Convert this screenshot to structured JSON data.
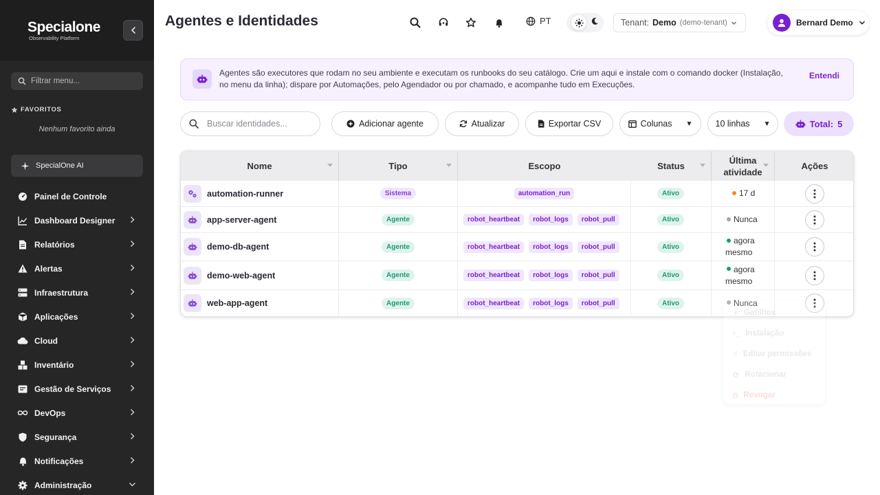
{
  "brand": {
    "logo_word": "Specialone",
    "logo_sub": "Observability Platform"
  },
  "sidebar": {
    "filter_placeholder": "Filtrar menu...",
    "favorites_title": "FAVORITOS",
    "favorites_empty": "Nenhum favorito ainda",
    "ai_label": "SpecialOne AI",
    "items": [
      {
        "label": "Painel de Controle",
        "icon": "dashboard-icon",
        "chevron": ""
      },
      {
        "label": "Dashboard Designer",
        "icon": "chart-line-icon",
        "chevron": "right"
      },
      {
        "label": "Relatórios",
        "icon": "report-icon",
        "chevron": "right"
      },
      {
        "label": "Alertas",
        "icon": "alert-icon",
        "chevron": "right"
      },
      {
        "label": "Infraestrutura",
        "icon": "server-icon",
        "chevron": "right"
      },
      {
        "label": "Aplicações",
        "icon": "package-icon",
        "chevron": "right"
      },
      {
        "label": "Cloud",
        "icon": "cloud-icon",
        "chevron": "right"
      },
      {
        "label": "Inventário",
        "icon": "boxes-icon",
        "chevron": "right"
      },
      {
        "label": "Gestão de Serviços",
        "icon": "service-icon",
        "chevron": "right"
      },
      {
        "label": "DevOps",
        "icon": "infinity-icon",
        "chevron": "right"
      },
      {
        "label": "Segurança",
        "icon": "shield-icon",
        "chevron": "right"
      },
      {
        "label": "Notificações",
        "icon": "bell-icon",
        "chevron": "right"
      },
      {
        "label": "Administração",
        "icon": "gear-icon",
        "chevron": "down"
      }
    ]
  },
  "header": {
    "title": "Agentes e Identidades",
    "lang": "PT",
    "tenant_label": "Tenant:",
    "tenant_name": "Demo",
    "tenant_slug": "(demo-tenant)",
    "user_name": "Bernard Demo"
  },
  "banner": {
    "text": "Agentes são executores que rodam no seu ambiente e executam os runbooks do seu catálogo. Crie um aqui e instale com o comando docker (Instalação, no menu da linha); dispare por Automações, pelo Agendador ou por chamado, e acompanhe tudo em Execuções.",
    "dismiss": "Entendi"
  },
  "toolbar": {
    "search_placeholder": "Buscar identidades...",
    "add": "Adicionar agente",
    "refresh": "Atualizar",
    "export": "Exportar CSV",
    "columns": "Colunas",
    "rows": "10 linhas",
    "total_label": "Total:",
    "total_value": "5"
  },
  "table": {
    "headers": {
      "name": "Nome",
      "type": "Tipo",
      "scope": "Escopo",
      "status": "Status",
      "last_line1": "Última",
      "last_line2": "atividade",
      "actions": "Ações"
    },
    "rows": [
      {
        "name": "automation-runner",
        "type": "Sistema",
        "type_kind": "sys",
        "scopes": [
          "automation_run"
        ],
        "status": "Ativo",
        "activity": [
          "17 d"
        ],
        "dot": "#f08a24"
      },
      {
        "name": "app-server-agent",
        "type": "Agente",
        "type_kind": "ag",
        "scopes": [
          "robot_heartbeat",
          "robot_logs",
          "robot_pull"
        ],
        "status": "Ativo",
        "activity": [
          "Nunca"
        ],
        "dot": "#a0a4ad"
      },
      {
        "name": "demo-db-agent",
        "type": "Agente",
        "type_kind": "ag",
        "scopes": [
          "robot_heartbeat",
          "robot_logs",
          "robot_pull"
        ],
        "status": "Ativo",
        "activity": [
          "agora",
          "mesmo"
        ],
        "dot": "#1a9a78"
      },
      {
        "name": "demo-web-agent",
        "type": "Agente",
        "type_kind": "ag",
        "scopes": [
          "robot_heartbeat",
          "robot_logs",
          "robot_pull"
        ],
        "status": "Ativo",
        "activity": [
          "agora",
          "mesmo"
        ],
        "dot": "#1a9a78"
      },
      {
        "name": "web-app-agent",
        "type": "Agente",
        "type_kind": "ag",
        "scopes": [
          "robot_heartbeat",
          "robot_logs",
          "robot_pull"
        ],
        "status": "Ativo",
        "activity": [
          "Nunca"
        ],
        "dot": "#a0a4ad"
      }
    ]
  },
  "row_menu": {
    "items": [
      "Gatilhos",
      "Instalação",
      "Editar permissões",
      "Rotacionar",
      "Revogar"
    ]
  },
  "colors": {
    "accent": "#7a22d0",
    "sidebar_bg": "#262626",
    "success": "#1a9a78"
  }
}
